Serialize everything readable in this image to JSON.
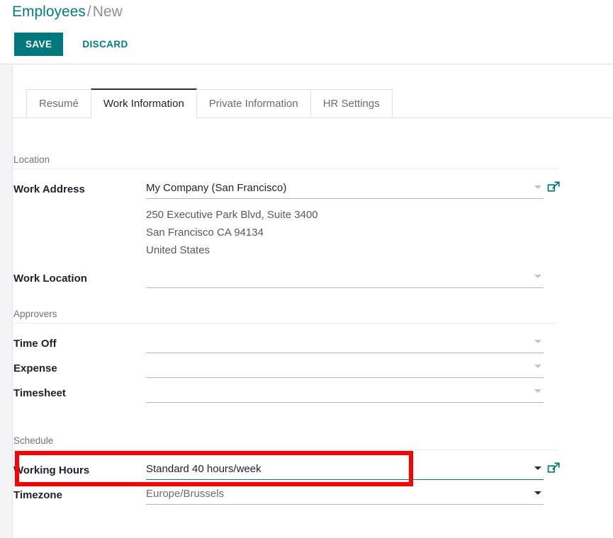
{
  "breadcrumb": {
    "root": "Employees",
    "separator": "/",
    "current": "New"
  },
  "toolbar": {
    "save_label": "SAVE",
    "discard_label": "DISCARD"
  },
  "tabs": [
    {
      "label": "Resumé",
      "active": false
    },
    {
      "label": "Work Information",
      "active": true
    },
    {
      "label": "Private Information",
      "active": false
    },
    {
      "label": "HR Settings",
      "active": false
    }
  ],
  "groups": {
    "location": {
      "title": "Location",
      "work_address": {
        "label": "Work Address",
        "value": "My Company (San Francisco)",
        "placeholder": "",
        "address_lines": [
          "250 Executive Park Blvd, Suite 3400",
          "San Francisco CA 94134",
          "United States"
        ]
      },
      "work_location": {
        "label": "Work Location",
        "value": "",
        "placeholder": ""
      }
    },
    "approvers": {
      "title": "Approvers",
      "time_off": {
        "label": "Time Off",
        "value": "",
        "placeholder": ""
      },
      "expense": {
        "label": "Expense",
        "value": "",
        "placeholder": ""
      },
      "timesheet": {
        "label": "Timesheet",
        "value": "",
        "placeholder": ""
      }
    },
    "schedule": {
      "title": "Schedule",
      "working_hours": {
        "label": "Working Hours",
        "value": "Standard 40 hours/week",
        "placeholder": ""
      },
      "timezone": {
        "label": "Timezone",
        "value": "Europe/Brussels",
        "placeholder": ""
      }
    }
  },
  "icons": {
    "external_link": "external-link-icon",
    "dropdown_caret": "chevron-down-icon"
  },
  "colors": {
    "accent_teal": "#00787d",
    "link_teal": "#017e84",
    "highlight_red": "#fe0000",
    "label_dark": "#22222e",
    "muted_grey": "#72727f"
  },
  "annotation": {
    "highlight_target": "working-hours-field"
  }
}
